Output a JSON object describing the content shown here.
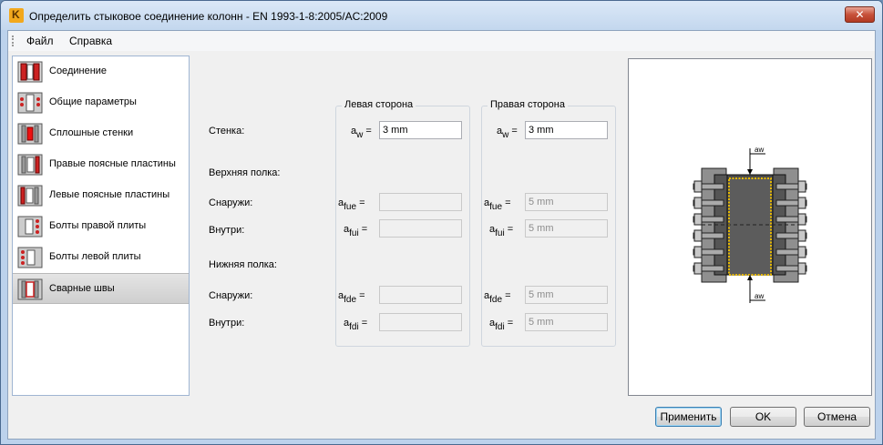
{
  "window": {
    "title": "Определить стыковое соединение колонн - EN 1993-1-8:2005/AC:2009",
    "close_glyph": "✕"
  },
  "menu": {
    "file": "Файл",
    "help": "Справка"
  },
  "nav": {
    "items": [
      {
        "label": "Соединение",
        "icon": "connection-icon"
      },
      {
        "label": "Общие параметры",
        "icon": "general-params-icon"
      },
      {
        "label": "Сплошные стенки",
        "icon": "web-plates-icon"
      },
      {
        "label": "Правые поясные пластины",
        "icon": "right-flange-plates-icon"
      },
      {
        "label": "Левые поясные пластины",
        "icon": "left-flange-plates-icon"
      },
      {
        "label": "Болты правой плиты",
        "icon": "right-plate-bolts-icon"
      },
      {
        "label": "Болты левой плиты",
        "icon": "left-plate-bolts-icon"
      },
      {
        "label": "Сварные швы",
        "icon": "welds-icon",
        "selected": true
      }
    ]
  },
  "form": {
    "left_title": "Левая сторона",
    "right_title": "Правая сторона",
    "web_label": "Стенка:",
    "top_flange_label": "Верхняя полка:",
    "outside_label": "Снаружи:",
    "inside_label": "Внутри:",
    "bottom_flange_label": "Нижняя полка:",
    "outside_label_2": "Снаружи:",
    "inside_label_2": "Внутри:",
    "sym_a": "a",
    "sym_eq": "=",
    "sub_w": "w",
    "sub_fue": "fue",
    "sub_fui": "fui",
    "sub_fde": "fde",
    "sub_fdi": "fdi",
    "left": {
      "aw": "3 mm",
      "afue": "",
      "afui": "",
      "afde": "",
      "afdi": ""
    },
    "right": {
      "aw": "3 mm",
      "afue": "5 mm",
      "afui": "5 mm",
      "afde": "5 mm",
      "afdi": "5 mm"
    }
  },
  "preview": {
    "aw_top": "aw",
    "aw_bottom": "aw",
    "weld_color": "#e6b800"
  },
  "buttons": {
    "apply": "Применить",
    "ok": "OK",
    "cancel": "Отмена"
  }
}
